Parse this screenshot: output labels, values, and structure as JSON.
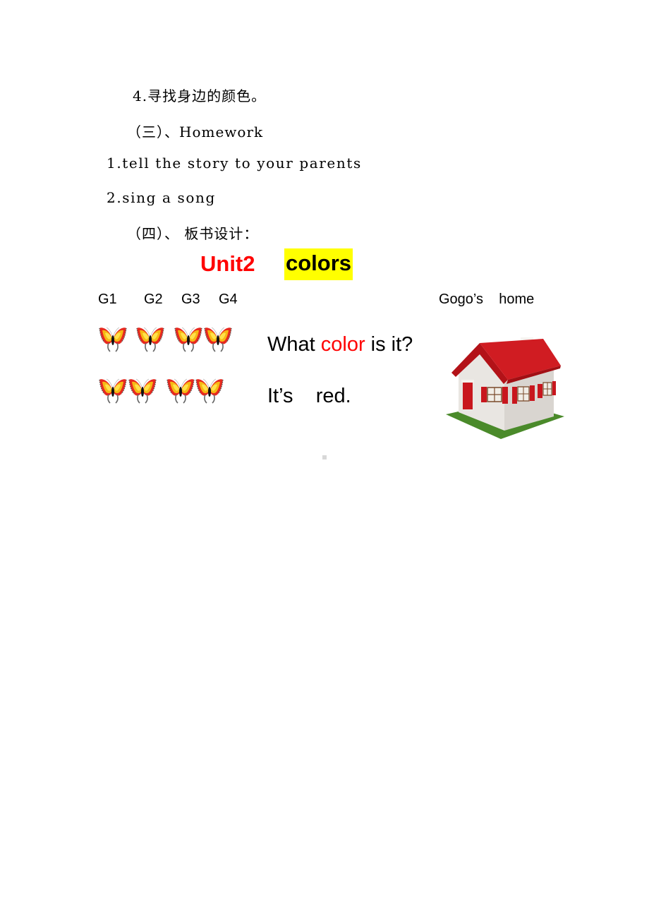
{
  "document": {
    "lines": [
      "4.寻找身边的颜色。",
      "（三）、Homework",
      "1.tell the story to your parents",
      "2.sing a song",
      "（四）、 板书设计："
    ],
    "board": {
      "unit_label": "Unit2",
      "topic_label": "colors",
      "group_labels": [
        "G1",
        "G2",
        "G3",
        "G4"
      ],
      "house_caption": "Gogo’s    home",
      "question": {
        "before": "What ",
        "highlight": "color",
        "after": " is it?"
      },
      "answer": "It’s    red.",
      "butterfly_rows": [
        {
          "count": 4
        },
        {
          "count": 4
        }
      ]
    },
    "colors": {
      "accent_red": "#ff0000",
      "highlight_yellow": "#ffff00",
      "roof_red": "#c8161d",
      "grass_green": "#4a8a2a"
    },
    "icons": {
      "butterfly": "butterfly-icon",
      "house": "house-illustration"
    }
  }
}
